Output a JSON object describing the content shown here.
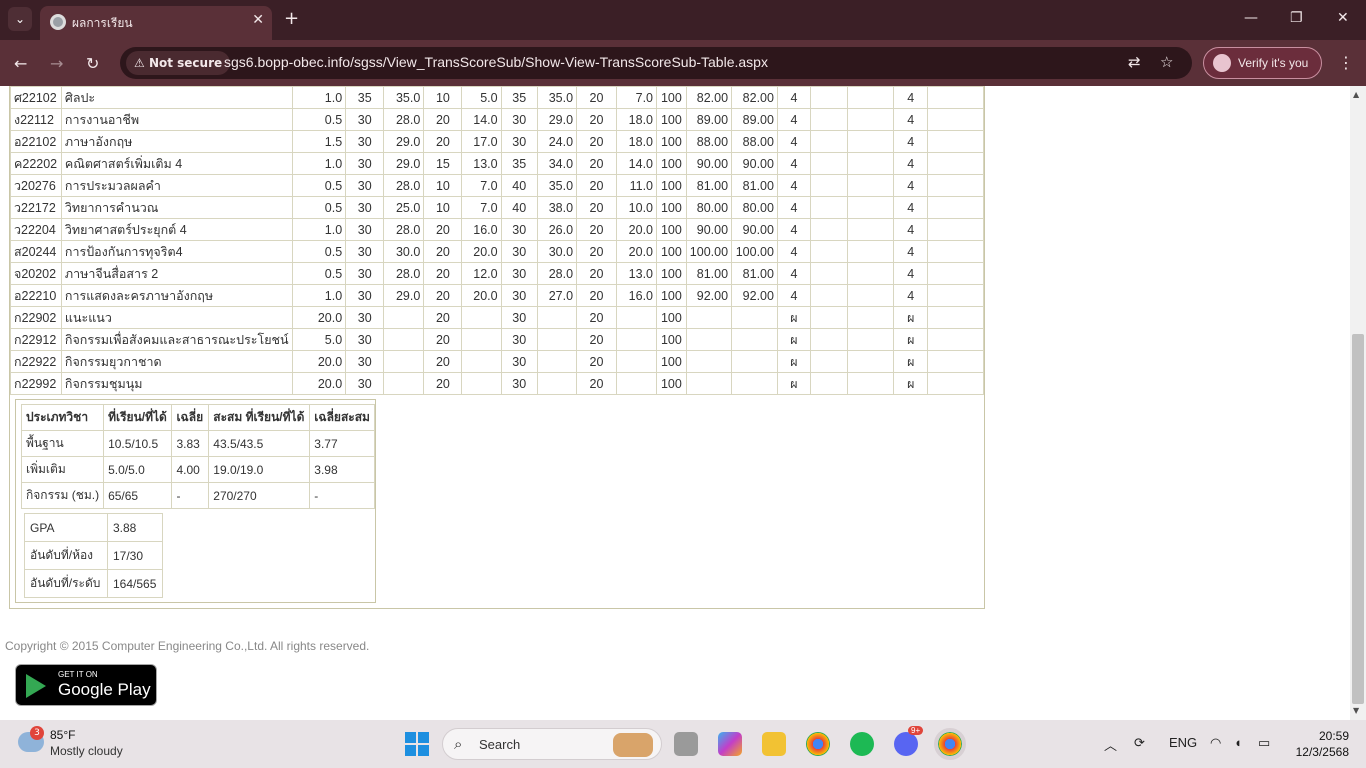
{
  "browser": {
    "tab_title": "ผลการเรียน",
    "security_label": "Not secure",
    "url": "sgs6.bopp-obec.info/sgss/View_TransScoreSub/Show-View-TransScoreSub-Table.aspx",
    "verify_label": "Verify it's you"
  },
  "grades": {
    "rows": [
      [
        "ศ22102",
        "ศิลปะ",
        "1.0",
        "35",
        "35.0",
        "10",
        "5.0",
        "35",
        "35.0",
        "20",
        "7.0",
        "100",
        "82.00",
        "82.00",
        "4",
        "",
        "",
        "4",
        ""
      ],
      [
        "ง22112",
        "การงานอาชีพ",
        "0.5",
        "30",
        "28.0",
        "20",
        "14.0",
        "30",
        "29.0",
        "20",
        "18.0",
        "100",
        "89.00",
        "89.00",
        "4",
        "",
        "",
        "4",
        ""
      ],
      [
        "อ22102",
        "ภาษาอังกฤษ",
        "1.5",
        "30",
        "29.0",
        "20",
        "17.0",
        "30",
        "24.0",
        "20",
        "18.0",
        "100",
        "88.00",
        "88.00",
        "4",
        "",
        "",
        "4",
        ""
      ],
      [
        "ค22202",
        "คณิตศาสตร์เพิ่มเติม  4",
        "1.0",
        "30",
        "29.0",
        "15",
        "13.0",
        "35",
        "34.0",
        "20",
        "14.0",
        "100",
        "90.00",
        "90.00",
        "4",
        "",
        "",
        "4",
        ""
      ],
      [
        "ว20276",
        "การประมวลผลคำ",
        "0.5",
        "30",
        "28.0",
        "10",
        "7.0",
        "40",
        "35.0",
        "20",
        "11.0",
        "100",
        "81.00",
        "81.00",
        "4",
        "",
        "",
        "4",
        ""
      ],
      [
        "ว22172",
        "วิทยาการคำนวณ",
        "0.5",
        "30",
        "25.0",
        "10",
        "7.0",
        "40",
        "38.0",
        "20",
        "10.0",
        "100",
        "80.00",
        "80.00",
        "4",
        "",
        "",
        "4",
        ""
      ],
      [
        "ว22204",
        "วิทยาศาสตร์ประยุกต์  4",
        "1.0",
        "30",
        "28.0",
        "20",
        "16.0",
        "30",
        "26.0",
        "20",
        "20.0",
        "100",
        "90.00",
        "90.00",
        "4",
        "",
        "",
        "4",
        ""
      ],
      [
        "ส20244",
        "การป้องกันการทุจริต4",
        "0.5",
        "30",
        "30.0",
        "20",
        "20.0",
        "30",
        "30.0",
        "20",
        "20.0",
        "100",
        "100.00",
        "100.00",
        "4",
        "",
        "",
        "4",
        ""
      ],
      [
        "จ20202",
        "ภาษาจีนสื่อสาร  2",
        "0.5",
        "30",
        "28.0",
        "20",
        "12.0",
        "30",
        "28.0",
        "20",
        "13.0",
        "100",
        "81.00",
        "81.00",
        "4",
        "",
        "",
        "4",
        ""
      ],
      [
        "อ22210",
        "การแสดงละครภาษาอังกฤษ",
        "1.0",
        "30",
        "29.0",
        "20",
        "20.0",
        "30",
        "27.0",
        "20",
        "16.0",
        "100",
        "92.00",
        "92.00",
        "4",
        "",
        "",
        "4",
        ""
      ],
      [
        "ก22902",
        "แนะแนว",
        "20.0",
        "30",
        "",
        "20",
        "",
        "30",
        "",
        "20",
        "",
        "100",
        "",
        "",
        "ผ",
        "",
        "",
        "ผ",
        ""
      ],
      [
        "ก22912",
        "กิจกรรมเพื่อสังคมและสาธารณะประโยชน์",
        "5.0",
        "30",
        "",
        "20",
        "",
        "30",
        "",
        "20",
        "",
        "100",
        "",
        "",
        "ผ",
        "",
        "",
        "ผ",
        ""
      ],
      [
        "ก22922",
        "กิจกรรมยุวกาชาด",
        "20.0",
        "30",
        "",
        "20",
        "",
        "30",
        "",
        "20",
        "",
        "100",
        "",
        "",
        "ผ",
        "",
        "",
        "ผ",
        ""
      ],
      [
        "ก22992",
        "กิจกรรมชุมนุม",
        "20.0",
        "30",
        "",
        "20",
        "",
        "30",
        "",
        "20",
        "",
        "100",
        "",
        "",
        "ผ",
        "",
        "",
        "ผ",
        ""
      ]
    ]
  },
  "summary": {
    "headers": [
      "ประเภทวิชา",
      "ที่เรียน/ที่ได้",
      "เฉลี่ย",
      "สะสม  ที่เรียน/ที่ได้",
      "เฉลี่ยสะสม"
    ],
    "rows": [
      [
        "พื้นฐาน",
        "10.5/10.5",
        "3.83",
        "43.5/43.5",
        "3.77"
      ],
      [
        "เพิ่มเติม",
        "5.0/5.0",
        "4.00",
        "19.0/19.0",
        "3.98"
      ],
      [
        "กิจกรรม  (ชม.)",
        "65/65",
        "-",
        "270/270",
        "-"
      ]
    ],
    "gpa_label": "GPA",
    "gpa_value": "3.88",
    "rank_room_label": "อันดับที่/ห้อง",
    "rank_room_value": "17/30",
    "rank_level_label": "อันดับที่/ระดับ",
    "rank_level_value": "164/565"
  },
  "footer": {
    "copyright": "Copyright © 2015 Computer Engineering Co.,Ltd. All rights reserved.",
    "play_small": "GET IT ON",
    "play_big": "Google Play"
  },
  "taskbar": {
    "weather_badge": "3",
    "temperature": "85°F",
    "condition": "Mostly cloudy",
    "search_label": "Search",
    "discord_badge": "9+",
    "language": "ENG",
    "time": "20:59",
    "date": "12/3/2568"
  }
}
